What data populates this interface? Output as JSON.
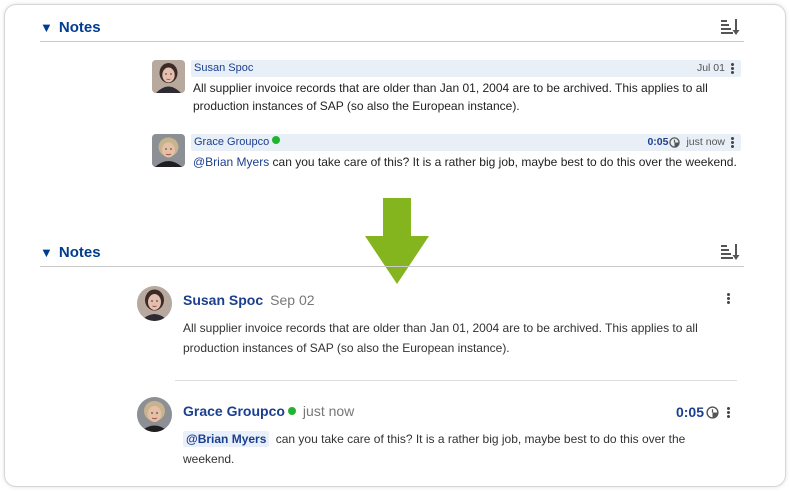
{
  "sections": {
    "top": {
      "title": "Notes",
      "toggle_glyph": "▼"
    },
    "bottom": {
      "title": "Notes",
      "toggle_glyph": "▼"
    }
  },
  "old_style": {
    "comments": [
      {
        "author": "Susan Spoc",
        "date": "Jul 01",
        "body": "All supplier invoice records that are older than Jan 01, 2004 are to be archived. This applies to all production instances of SAP (so also the European instance)."
      },
      {
        "author": "Grace Groupco",
        "online": true,
        "duration": "0:05",
        "date": "just now",
        "mention": "@Brian Myers",
        "body": " can you take care of this? It is a rather big job, maybe best to do this over the weekend."
      }
    ]
  },
  "new_style": {
    "comments": [
      {
        "author": "Susan Spoc",
        "date": "Sep 02",
        "body": "All supplier invoice records that are older than Jan 01, 2004 are to be archived. This applies to all production instances of SAP (so also the European instance)."
      },
      {
        "author": "Grace Groupco",
        "online": true,
        "duration": "0:05",
        "date": "just now",
        "mention": "@Brian Myers",
        "body": "can you take care of this? It is a rather big job, maybe best to do this over the weekend."
      }
    ]
  },
  "colors": {
    "link_blue": "#1b3f8f",
    "header_blue": "#003c8f",
    "arrow_green": "#84b51e",
    "online_green": "#1fb52e",
    "old_header_bg": "#e9eff7"
  },
  "icons": [
    "sort-icon",
    "kebab-menu-icon",
    "timer-icon",
    "down-arrow-icon",
    "online-status-icon"
  ]
}
